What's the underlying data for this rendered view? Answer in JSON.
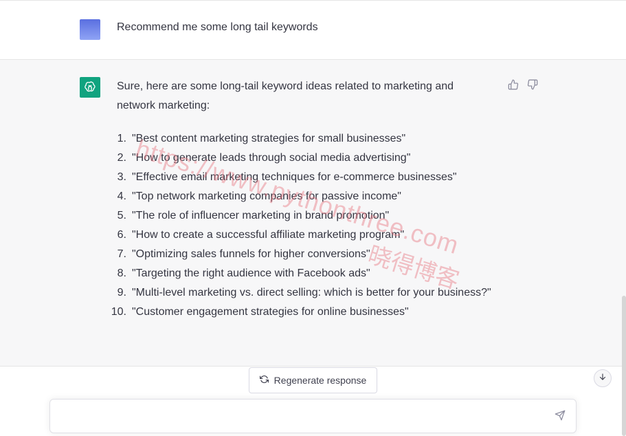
{
  "user_message": {
    "text": "Recommend me some long tail keywords"
  },
  "assistant_message": {
    "intro": "Sure, here are some long-tail keyword ideas related to marketing and network marketing:",
    "items": [
      {
        "num": "1.",
        "text": "\"Best content marketing strategies for small businesses\""
      },
      {
        "num": "2.",
        "text": "\"How to generate leads through social media advertising\""
      },
      {
        "num": "3.",
        "text": "\"Effective email marketing techniques for e-commerce businesses\""
      },
      {
        "num": "4.",
        "text": "\"Top network marketing companies for passive income\""
      },
      {
        "num": "5.",
        "text": "\"The role of influencer marketing in brand promotion\""
      },
      {
        "num": "6.",
        "text": "\"How to create a successful affiliate marketing program\""
      },
      {
        "num": "7.",
        "text": "\"Optimizing sales funnels for higher conversions\""
      },
      {
        "num": "8.",
        "text": "\"Targeting the right audience with Facebook ads\""
      },
      {
        "num": "9.",
        "text": "\"Multi-level marketing vs. direct selling: which is better for your business?\""
      },
      {
        "num": "10.",
        "text": "\"Customer engagement strategies for online businesses\""
      }
    ]
  },
  "watermark": {
    "url": "https://www.pythonthree.com",
    "cn": "晓得博客"
  },
  "actions": {
    "regenerate_label": "Regenerate response"
  },
  "composer": {
    "placeholder": "",
    "value": ""
  },
  "colors": {
    "accent": "#10a37f",
    "user_avatar": "#6b7fe8",
    "bot_background": "#f7f7f8",
    "watermark": "#e67882"
  },
  "icons": {
    "bot_avatar": "openai-logo-icon",
    "thumbs_up": "thumbs-up-icon",
    "thumbs_down": "thumbs-down-icon",
    "regenerate": "refresh-icon",
    "scroll_down": "arrow-down-icon",
    "send": "send-icon"
  }
}
